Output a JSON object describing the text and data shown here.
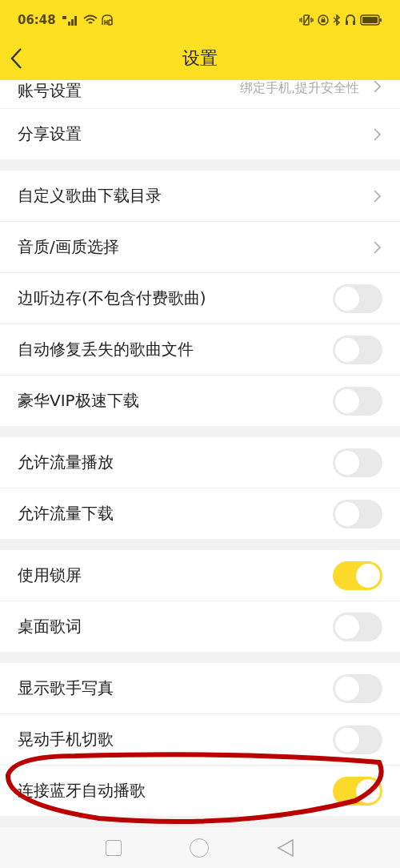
{
  "status_bar": {
    "time": "06:48"
  },
  "header": {
    "title": "设置"
  },
  "groups": [
    {
      "items": [
        {
          "kind": "link",
          "label": "账号设置",
          "value": "绑定手机,提升安全性"
        },
        {
          "kind": "link",
          "label": "分享设置"
        }
      ]
    },
    {
      "items": [
        {
          "kind": "link",
          "label": "自定义歌曲下载目录"
        },
        {
          "kind": "link",
          "label": "音质/画质选择"
        },
        {
          "kind": "toggle",
          "label": "边听边存(不包含付费歌曲)",
          "on": false
        },
        {
          "kind": "toggle",
          "label": "自动修复丢失的歌曲文件",
          "on": false
        },
        {
          "kind": "toggle",
          "label": "豪华VIP极速下载",
          "on": false
        }
      ]
    },
    {
      "items": [
        {
          "kind": "toggle",
          "label": "允许流量播放",
          "on": false
        },
        {
          "kind": "toggle",
          "label": "允许流量下载",
          "on": false
        }
      ]
    },
    {
      "items": [
        {
          "kind": "toggle",
          "label": "使用锁屏",
          "on": true
        },
        {
          "kind": "toggle",
          "label": "桌面歌词",
          "on": false
        }
      ]
    },
    {
      "items": [
        {
          "kind": "toggle",
          "label": "显示歌手写真",
          "on": false
        },
        {
          "kind": "toggle",
          "label": "晃动手机切歌",
          "on": false
        },
        {
          "kind": "toggle",
          "label": "连接蓝牙自动播歌",
          "on": true,
          "circled": true
        }
      ]
    }
  ]
}
